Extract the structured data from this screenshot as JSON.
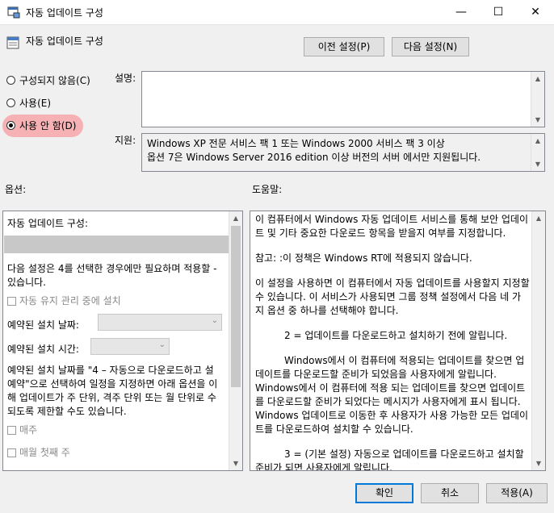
{
  "window": {
    "title": "자동 업데이트 구성",
    "minimize": "—",
    "maximize": "☐",
    "close": "✕"
  },
  "header": {
    "policy_name": "자동 업데이트 구성",
    "prev_button": "이전 설정(P)",
    "next_button": "다음 설정(N)"
  },
  "state": {
    "options": [
      {
        "label": "구성되지 않음(C)",
        "selected": false
      },
      {
        "label": "사용(E)",
        "selected": false
      },
      {
        "label": "사용 안 함(D)",
        "selected": true
      }
    ]
  },
  "comment": {
    "label": "설명:",
    "value": ""
  },
  "supported": {
    "label": "지원:",
    "line1": "Windows XP 전문 서비스 팩 1 또는 Windows 2000 서비스 팩 3 이상",
    "line2": "옵션 7은 Windows Server 2016 edition 이상 버전의 서버 에서만 지원됩니다."
  },
  "options_panel": {
    "heading": "옵션:",
    "configure_label": "자동 업데이트 구성:",
    "note_line1": "다음 설정은 4를 선택한 경우에만 필요하며 적용할 -",
    "note_line2": "있습니다.",
    "maintenance_checkbox": "자동 유지 관리 중에 설치",
    "scheduled_day_label": "예약된 설치 날짜:",
    "scheduled_time_label": "예약된 설치 시간:",
    "desc_line1": "예약된 설치 날짜를 \"4 – 자동으로 다운로드하고 설",
    "desc_line2": "예약\"으로 선택하여 일정을 지정하면 아래 옵션을 이",
    "desc_line3": "해 업데이트가 주 단위, 격주 단위 또는 월 단위로 수",
    "desc_line4": "되도록 제한할 수도 있습니다.",
    "every_week": "매주",
    "first_week": "매월 첫째 주"
  },
  "help_panel": {
    "heading": "도움말:",
    "p1": "이 컴퓨터에서 Windows 자동 업데이트 서비스를 통해 보안 업데이트 및 기타 중요한 다운로드 항목을 받을지 여부를 지정합니다.",
    "p2": "참고: :이 정책은 Windows RT에 적용되지 않습니다.",
    "p3": "이 설정을 사용하면 이 컴퓨터에서 자동 업데이트를 사용할지 지정할 수 있습니다. 이 서비스가 사용되면 그룹 정책 설정에서 다음 네 가지 옵션 중 하나를 선택해야 합니다.",
    "p4": "2 = 업데이트를 다운로드하고 설치하기 전에 알립니다.",
    "p5": "Windows에서 이 컴퓨터에 적용되는 업데이트를 찾으면 업데이트를 다운로드할 준비가 되었음을 사용자에게 알립니다. Windows에서 이 컴퓨터에 적용 되는 업데이트를 찾으면 업데이트를 다운로드할 준비가 되었다는 메시지가 사용자에게 표시 됩니다. Windows 업데이트로 이동한 후 사용자가 사용 가능한 모든 업데이트를 다운로드하여 설치할 수 있습니다.",
    "p6": "3 = (기본 설정) 자동으로 업데이트를 다운로드하고 설치할 준비가 되면 사용자에게 알립니다."
  },
  "footer": {
    "ok": "확인",
    "cancel": "취소",
    "apply": "적용(A)"
  }
}
